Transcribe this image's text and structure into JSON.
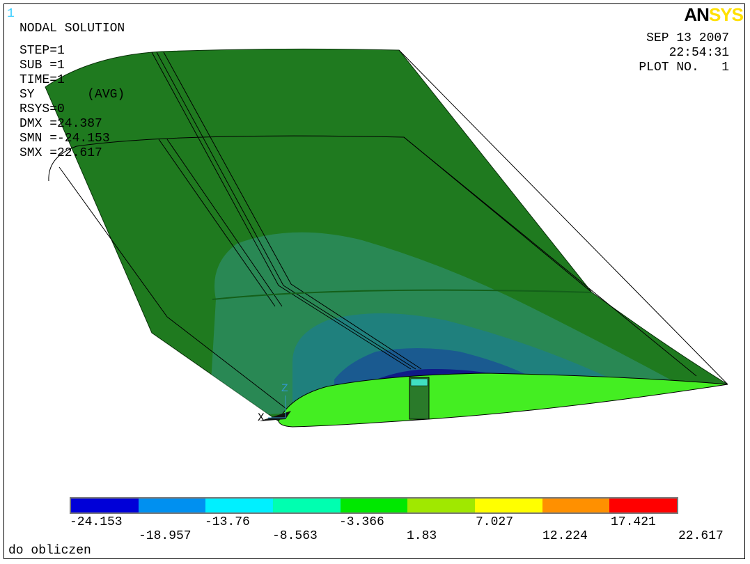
{
  "window_number": "1",
  "logo": {
    "part1": "AN",
    "part2": "SYS",
    "color1": "#000000",
    "color2": "#ffe000"
  },
  "header": {
    "title": "NODAL SOLUTION",
    "lines": [
      "STEP=1",
      "SUB =1",
      "TIME=1",
      "SY       (AVG)",
      "RSYS=0",
      "DMX =24.387",
      "SMN =-24.153",
      "SMX =22.617"
    ]
  },
  "datetime": {
    "date": "SEP 13 2007",
    "time": "22:54:31",
    "plot": "PLOT NO.   1"
  },
  "triad": {
    "z_label": "Z",
    "x_label": "X"
  },
  "legend": {
    "colors": [
      "#0000d8",
      "#0090f0",
      "#00f0ff",
      "#00ffb0",
      "#00e800",
      "#a0e800",
      "#ffff00",
      "#ff9000",
      "#ff0000"
    ],
    "upper_labels": [
      "-24.153",
      "-13.76",
      "-3.366",
      "7.027",
      "17.421"
    ],
    "lower_labels": [
      "-18.957",
      "-8.563",
      "1.83",
      "12.224",
      "22.617"
    ]
  },
  "footer_title": "do obliczen"
}
